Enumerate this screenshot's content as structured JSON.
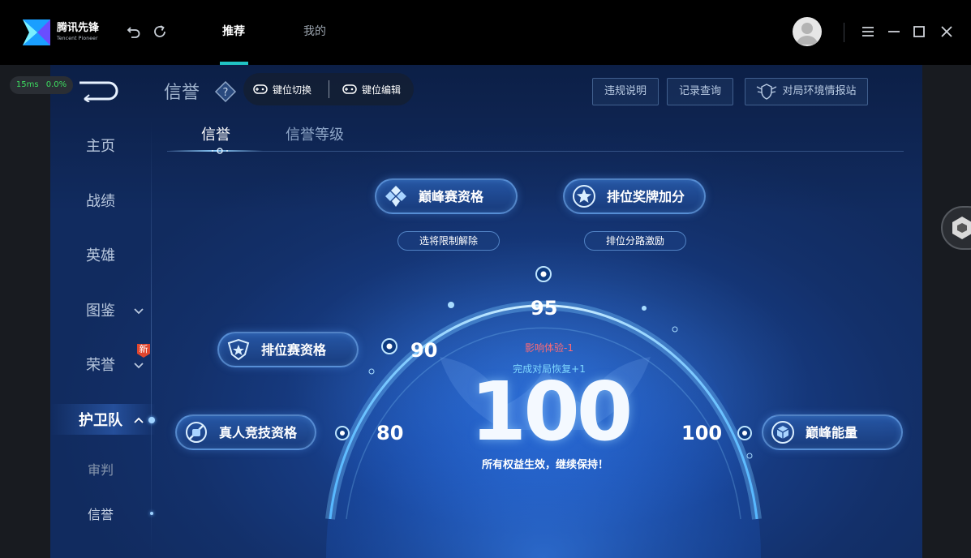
{
  "app": {
    "brand": "腾讯先锋",
    "brand_sub": "Tencent Pioneer",
    "nav_tabs": [
      {
        "label": "推荐",
        "active": true
      },
      {
        "label": "我的",
        "active": false
      }
    ],
    "accent_color": "#21c3c4"
  },
  "stats": {
    "latency": "15ms",
    "loss": "0.0%"
  },
  "game": {
    "page_title": "信誉",
    "keybar": {
      "switch_label": "键位切换",
      "edit_label": "键位编辑"
    },
    "header_buttons": {
      "violation": "违规说明",
      "records": "记录查询",
      "environment": "对局环境情报站"
    },
    "sidebar": {
      "items": [
        {
          "label": "主页"
        },
        {
          "label": "战绩"
        },
        {
          "label": "英雄"
        },
        {
          "label": "图鉴"
        },
        {
          "label": "荣誉"
        },
        {
          "label": "护卫队"
        },
        {
          "label": "审判"
        },
        {
          "label": "信誉"
        }
      ],
      "new_badge": "新"
    },
    "subtabs": [
      {
        "label": "信誉",
        "active": true
      },
      {
        "label": "信誉等级",
        "active": false
      }
    ],
    "privileges": {
      "peak_qualification": "巅峰赛资格",
      "peak_sub": "选将限制解除",
      "rank_medal": "排位奖牌加分",
      "rank_sub": "排位分路激励",
      "ranked_qualification": "排位赛资格",
      "real_competition": "真人竞技资格",
      "peak_energy": "巅峰能量"
    },
    "gauge": {
      "ticks": [
        "80",
        "90",
        "95",
        "100"
      ],
      "score": "100",
      "effect_negative": "影响体验-1",
      "effect_positive": "完成对局恢复+1",
      "status": "所有权益生效，继续保持！"
    }
  }
}
